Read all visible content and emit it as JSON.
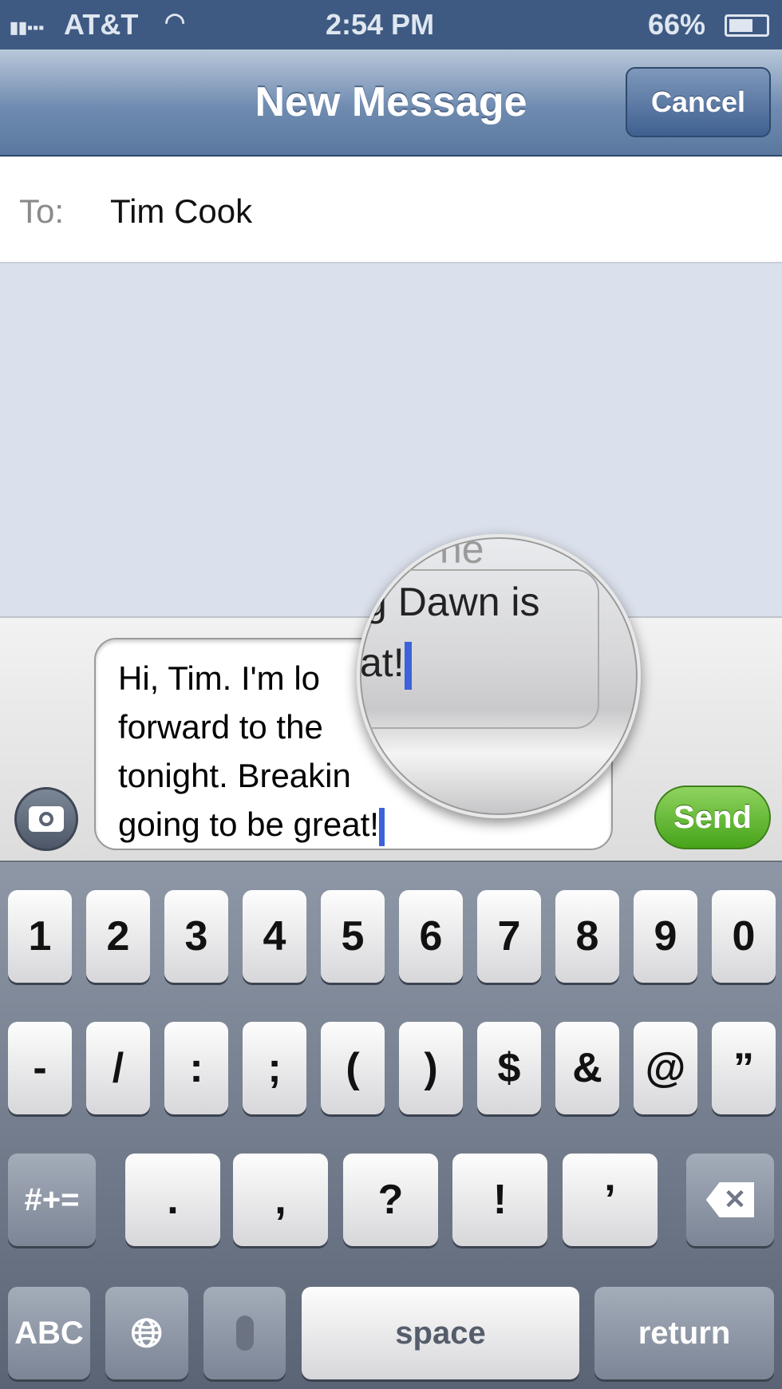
{
  "status": {
    "carrier": "AT&T",
    "time": "2:54 PM",
    "battery": "66%",
    "battery_level": 0.66
  },
  "nav": {
    "title": "New Message",
    "cancel": "Cancel"
  },
  "to": {
    "label": "To:",
    "value": "Tim Cook"
  },
  "composer": {
    "lines": [
      "Hi, Tim. I'm lo",
      "forward to the",
      "tonight. Breakin",
      "going to be great!"
    ],
    "send": "Send"
  },
  "magnifier": {
    "ghost": "he",
    "line1": "g Dawn is",
    "line2": "at!"
  },
  "keyboard": {
    "row1": [
      "1",
      "2",
      "3",
      "4",
      "5",
      "6",
      "7",
      "8",
      "9",
      "0"
    ],
    "row2": [
      "-",
      "/",
      ":",
      ";",
      "(",
      ")",
      "$",
      "&",
      "@",
      "”"
    ],
    "row3": {
      "mode": "#+=",
      "keys": [
        ".",
        ",",
        "?",
        "!",
        "’"
      ]
    },
    "row4": {
      "abc": "ABC",
      "space": "space",
      "return": "return"
    }
  },
  "colors": {
    "nav": "#5a789f",
    "send": "#47a41a",
    "cursor": "#3c63d9"
  }
}
